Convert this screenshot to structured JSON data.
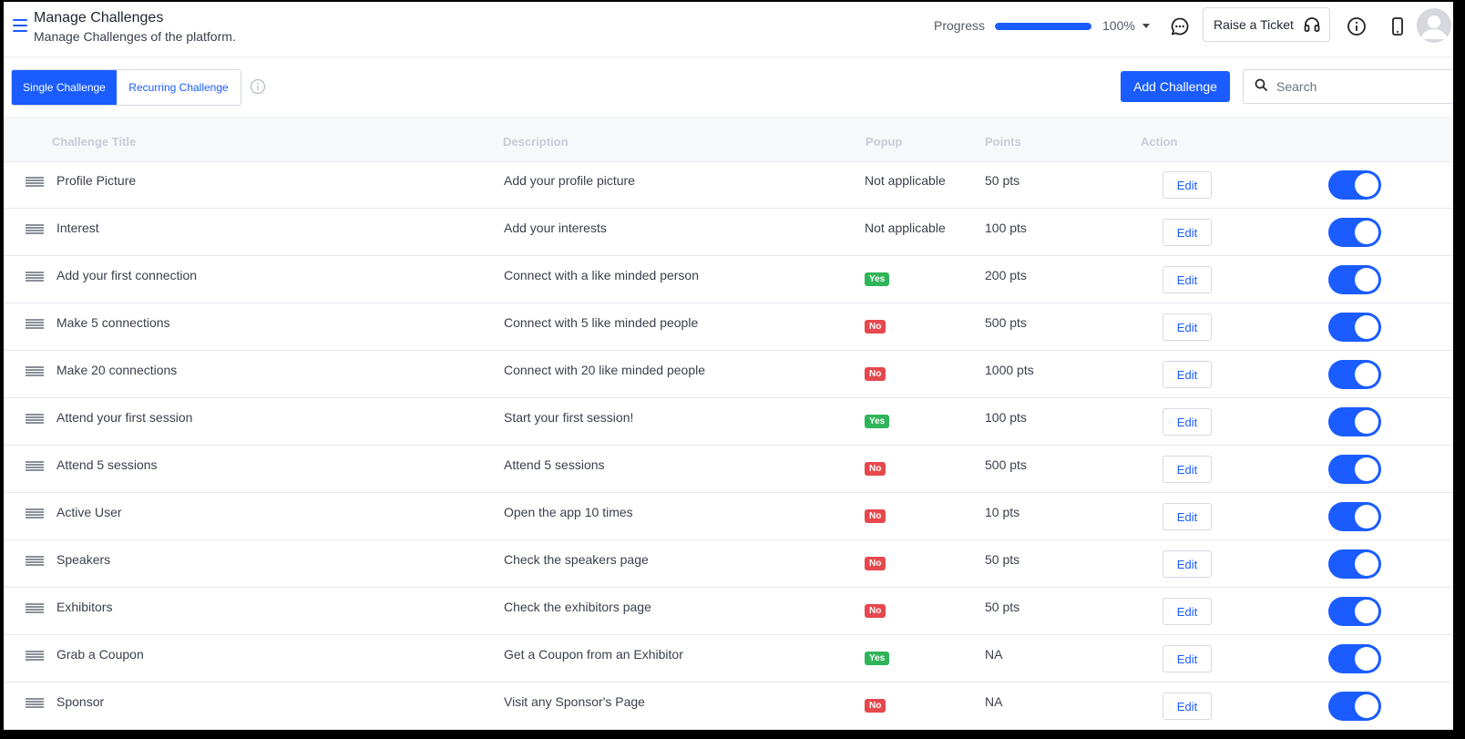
{
  "header": {
    "title": "Manage Challenges",
    "subtitle": "Manage Challenges of the platform.",
    "progress_label": "Progress",
    "progress_value": "100%",
    "progress_percent": 100,
    "raise_ticket_label": "Raise a Ticket"
  },
  "toolbar": {
    "tabs": [
      {
        "label": "Single Challenge",
        "active": true
      },
      {
        "label": "Recurring Challenge",
        "active": false
      }
    ],
    "add_label": "Add Challenge",
    "search_placeholder": "Search"
  },
  "table": {
    "columns": [
      "Challenge Title",
      "Description",
      "Popup",
      "Points",
      "Action"
    ],
    "edit_label": "Edit",
    "rows": [
      {
        "title": "Profile Picture",
        "description": "Add your profile picture",
        "popup": "Not applicable",
        "points": "50 pts",
        "enabled": true
      },
      {
        "title": "Interest",
        "description": "Add your interests",
        "popup": "Not applicable",
        "points": "100 pts",
        "enabled": true
      },
      {
        "title": "Add your first connection",
        "description": "Connect with a like minded person",
        "popup": "Yes",
        "points": "200 pts",
        "enabled": true
      },
      {
        "title": "Make 5 connections",
        "description": "Connect with 5 like minded people",
        "popup": "No",
        "points": "500 pts",
        "enabled": true
      },
      {
        "title": "Make 20 connections",
        "description": "Connect with 20 like minded people",
        "popup": "No",
        "points": "1000 pts",
        "enabled": true
      },
      {
        "title": "Attend your first session",
        "description": "Start your first session!",
        "popup": "Yes",
        "points": "100 pts",
        "enabled": true
      },
      {
        "title": "Attend 5 sessions",
        "description": "Attend 5 sessions",
        "popup": "No",
        "points": "500 pts",
        "enabled": true
      },
      {
        "title": "Active User",
        "description": "Open the app 10 times",
        "popup": "No",
        "points": "10 pts",
        "enabled": true
      },
      {
        "title": "Speakers",
        "description": "Check the speakers page",
        "popup": "No",
        "points": "50 pts",
        "enabled": true
      },
      {
        "title": "Exhibitors",
        "description": "Check the exhibitors page",
        "popup": "No",
        "points": "50 pts",
        "enabled": true
      },
      {
        "title": "Grab a Coupon",
        "description": "Get a Coupon from an Exhibitor",
        "popup": "Yes",
        "points": "NA",
        "enabled": true
      },
      {
        "title": "Sponsor",
        "description": "Visit any Sponsor's Page",
        "popup": "No",
        "points": "NA",
        "enabled": true
      }
    ]
  },
  "colors": {
    "accent": "#1a5cff",
    "yes_badge": "#2fb45a",
    "no_badge": "#e5484d"
  },
  "icons": {
    "menu": "hamburger-icon",
    "chat": "chat-icon",
    "ticket": "headset-icon",
    "info": "info-icon",
    "mobile": "mobile-icon",
    "avatar": "user-avatar-icon",
    "search": "search-icon",
    "drag": "drag-handle-icon"
  }
}
